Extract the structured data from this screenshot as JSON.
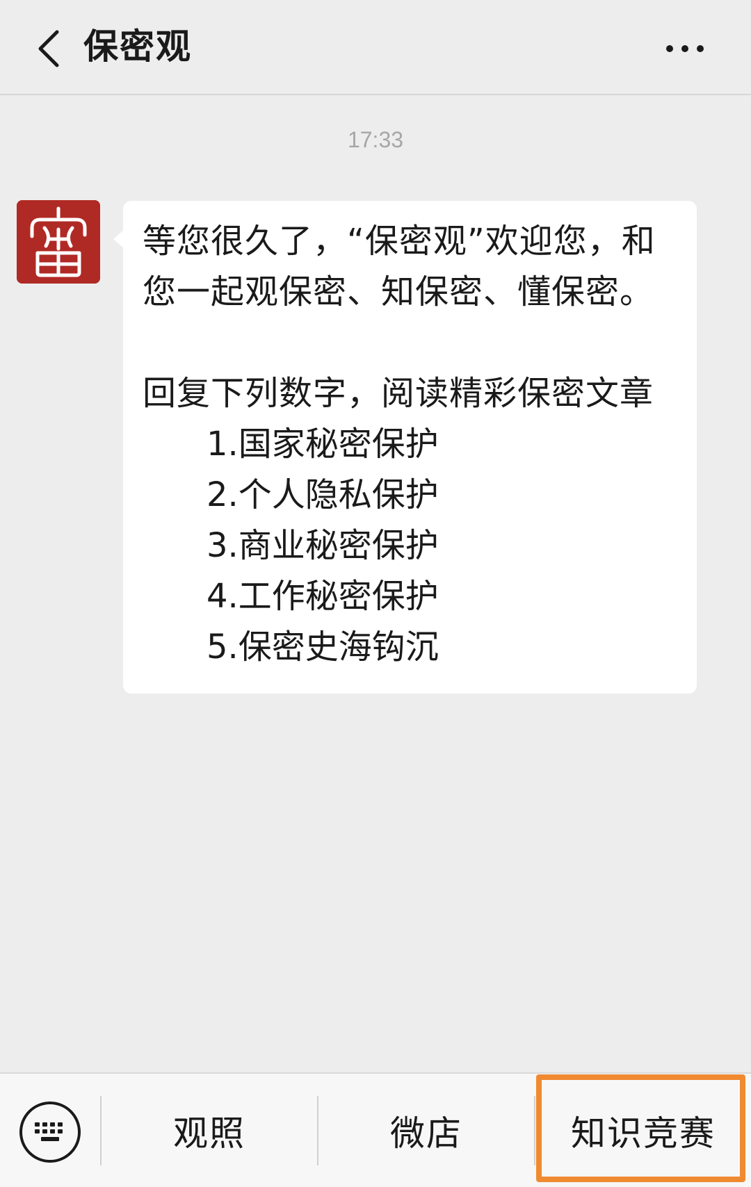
{
  "header": {
    "back_icon": "chevron-left-icon",
    "title": "保密观",
    "more_icon": "more-dots-icon"
  },
  "chat": {
    "timestamp": "17:33",
    "message": {
      "sender_avatar": "密",
      "greeting_line1": "等您很久了，“保密观”欢迎您，和",
      "greeting_line2": "您一起观保密、知保密、懂保密。",
      "instruction": "回复下列数字，阅读精彩保密文章",
      "items": [
        "1.国家秘密保护",
        "2.个人隐私保护",
        "3.商业秘密保护",
        "4.工作秘密保护",
        "5.保密史海钩沉"
      ]
    }
  },
  "bottom_menu": {
    "keyboard_icon": "keyboard-icon",
    "items": [
      {
        "label": "观照"
      },
      {
        "label": "微店"
      },
      {
        "label": "知识竞赛"
      }
    ],
    "highlight_color": "#f08a31"
  },
  "colors": {
    "background": "#ededed",
    "bubble": "#ffffff",
    "avatar": "#b02a25",
    "timestamp": "#a6a6a6"
  }
}
